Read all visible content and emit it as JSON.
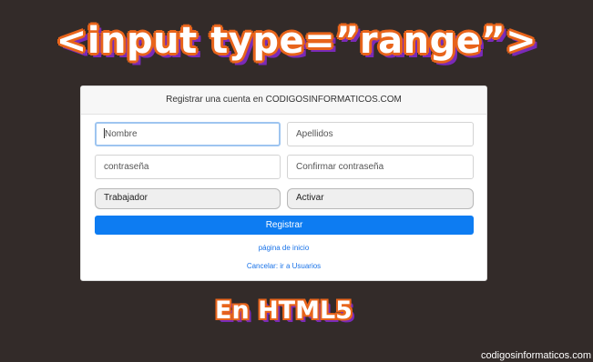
{
  "banner": {
    "title": "<input type=”range”>",
    "subtitle": "En HTML5",
    "watermark": "codigosinformaticos.com"
  },
  "form": {
    "header": "Registrar una cuenta en CODIGOSINFORMATICOS.COM",
    "nombre_placeholder": "Nombre",
    "apellidos_placeholder": "Apellidos",
    "contrasena_placeholder": "contraseña",
    "confirmar_placeholder": "Confirmar contraseña",
    "trabajador_label": "Trabajador",
    "activar_label": "Activar",
    "submit_label": "Registrar",
    "home_link": "página de inicio",
    "cancel_link": "Cancelar: ir a Usuarios"
  },
  "colors": {
    "background": "#332b29",
    "primary": "#0d7cf2",
    "title_outline": "#e8641b",
    "title_shadow": "#7a2ab8"
  }
}
